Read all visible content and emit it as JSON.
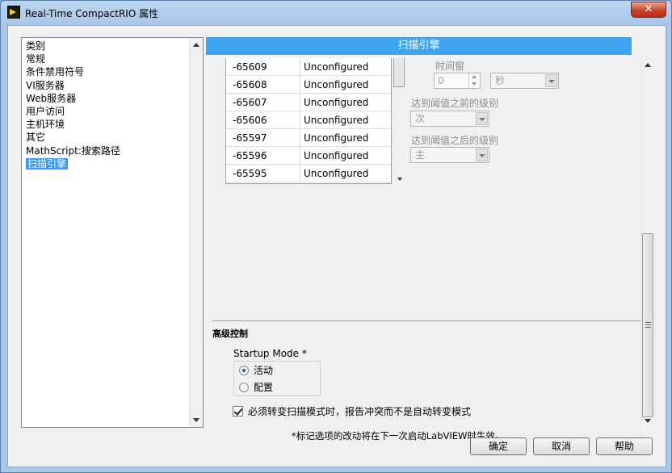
{
  "window": {
    "title": "Real-Time CompactRIO 属性",
    "close_label": "✕"
  },
  "category_list": {
    "header": "类别",
    "items": [
      {
        "label": "常规"
      },
      {
        "label": "条件禁用符号"
      },
      {
        "label": "VI服务器"
      },
      {
        "label": "Web服务器"
      },
      {
        "label": "用户访问"
      },
      {
        "label": "主机环境"
      },
      {
        "label": "其它"
      },
      {
        "label": "MathScript:搜索路径"
      },
      {
        "label": "扫描引擎"
      }
    ],
    "selected": "扫描引擎"
  },
  "panel": {
    "title": "扫描引擎",
    "table": {
      "rows": [
        {
          "code": "-65609",
          "status": "Unconfigured"
        },
        {
          "code": "-65608",
          "status": "Unconfigured"
        },
        {
          "code": "-65607",
          "status": "Unconfigured"
        },
        {
          "code": "-65606",
          "status": "Unconfigured"
        },
        {
          "code": "-65597",
          "status": "Unconfigured"
        },
        {
          "code": "-65596",
          "status": "Unconfigured"
        },
        {
          "code": "-65595",
          "status": "Unconfigured"
        }
      ]
    },
    "time_window": {
      "label": "时间窗",
      "value": "0",
      "unit": "秒"
    },
    "before_threshold": {
      "label": "达到阈值之前的级别",
      "value": "次"
    },
    "after_threshold": {
      "label": "达到阈值之后的级别",
      "value": "主"
    },
    "advanced": {
      "section_title": "高级控制",
      "startup_mode_label": "Startup Mode *",
      "options": [
        {
          "label": "活动",
          "selected": true
        },
        {
          "label": "配置",
          "selected": false
        }
      ],
      "checkbox_label": "必须转变扫描模式时，报告冲突而不是自动转变模式",
      "checkbox_checked": true,
      "note": "*标记选项的改动将在下一次启动LabVIEW时生效。"
    }
  },
  "buttons": {
    "ok": "确定",
    "cancel": "取消",
    "help": "帮助"
  }
}
